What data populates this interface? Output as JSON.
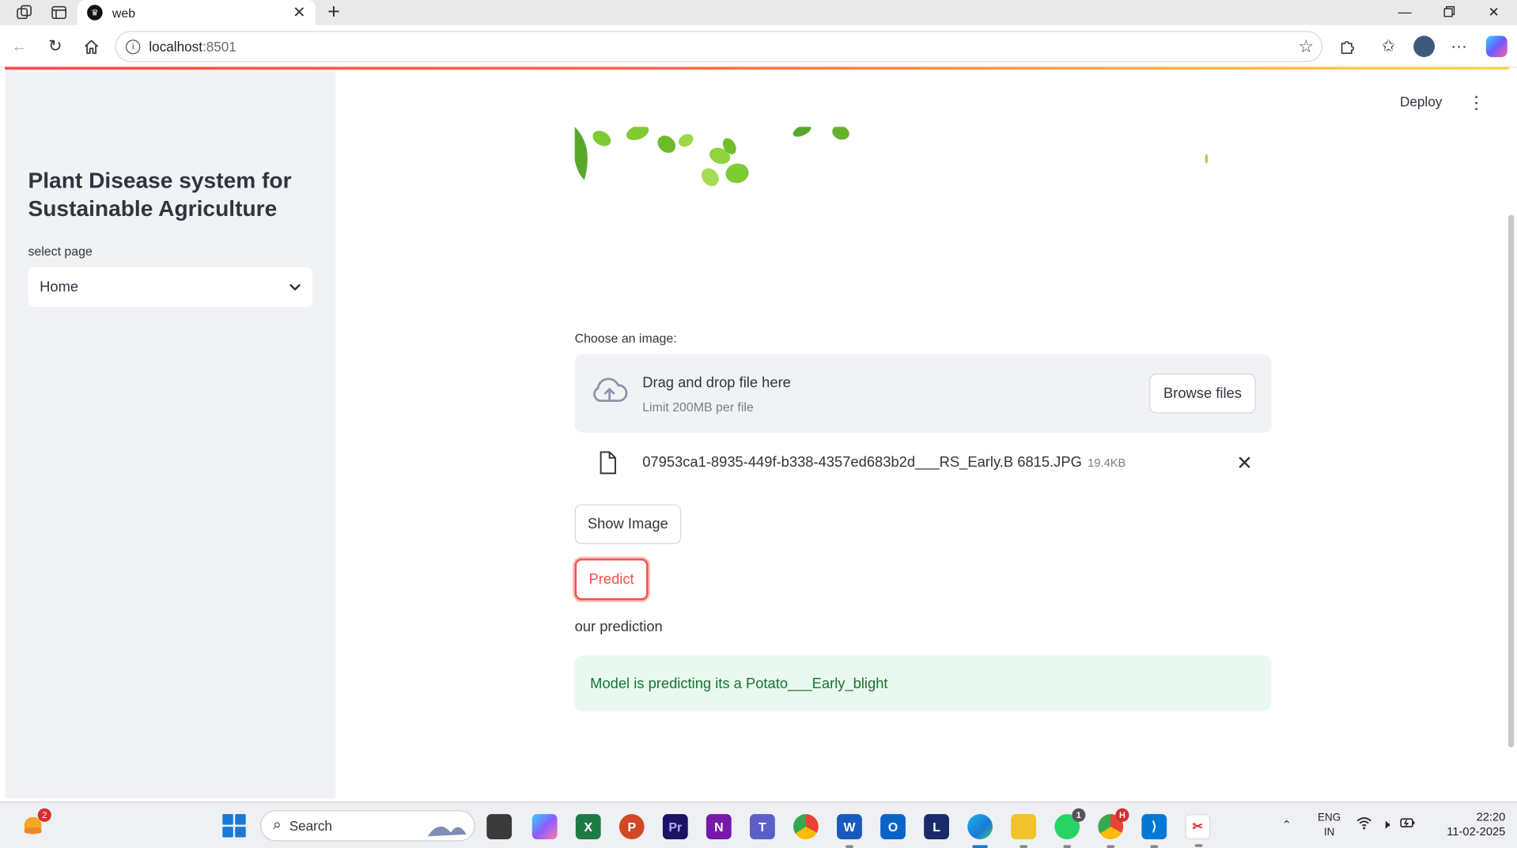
{
  "browser": {
    "tab_title": "web",
    "tab_close": "✕",
    "new_tab": "+",
    "url_host": "localhost",
    "url_port": ":8501"
  },
  "sidebar": {
    "title": "Plant Disease system for Sustainable Agriculture",
    "select_label": "select page",
    "select_value": "Home"
  },
  "header": {
    "deploy_label": "Deploy"
  },
  "uploader": {
    "label": "Choose an image:",
    "drop_text": "Drag and drop file here",
    "limit_text": "Limit 200MB per file",
    "browse_label": "Browse files",
    "file_name": "07953ca1-8935-449f-b338-4357ed683b2d___RS_Early.B 6815.JPG",
    "file_size": "19.4KB"
  },
  "actions": {
    "show_image_label": "Show Image",
    "predict_label": "Predict"
  },
  "result": {
    "heading": "our prediction",
    "message": "Model is predicting its a Potato___Early_blight"
  },
  "taskbar": {
    "search_placeholder": "Search",
    "widget_badge": "2",
    "whatsapp_badge": "1",
    "chrome_badge": "H",
    "lang_line1": "ENG",
    "lang_line2": "IN",
    "time": "22:20",
    "date": "11-02-2025"
  },
  "colors": {
    "accent": "#ff4b4b",
    "success_bg": "#e9f9ef",
    "success_text": "#177233",
    "sidebar_bg": "#f0f2f6"
  }
}
